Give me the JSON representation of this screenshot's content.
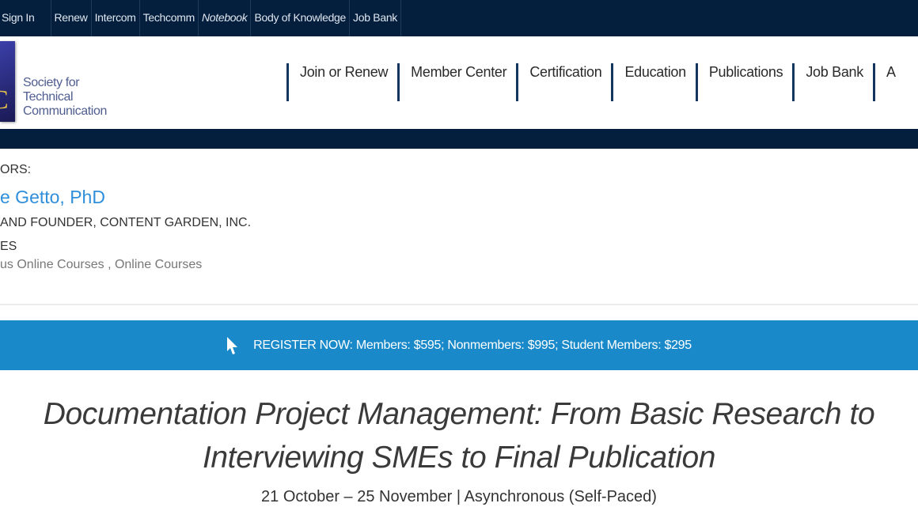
{
  "topbar": {
    "items": [
      "Sign In",
      "Renew",
      "Intercom",
      "Techcomm",
      "Notebook",
      "Body of Knowledge",
      "Job Bank"
    ]
  },
  "logo": {
    "lines": [
      "Society for",
      "Technical",
      "Communication"
    ],
    "mark": "C"
  },
  "nav": {
    "items": [
      "Join or Renew",
      "Member Center",
      "Certification",
      "Education",
      "Publications",
      "Job Bank",
      "A"
    ]
  },
  "content": {
    "instructors_label": "ORS:",
    "instructor_name": "e Getto, PhD",
    "instructor_title": "AND FOUNDER, CONTENT GARDEN, INC.",
    "categories_label": "ES",
    "categories_value": "us Online Courses , Online Courses"
  },
  "register": {
    "icon": "cursor-arrow-icon",
    "text": "REGISTER NOW: Members: $595; Nonmembers: $995; Student Members: $295"
  },
  "course": {
    "title_line1": "Documentation Project Management: From Basic Research to",
    "title_line2": "Interviewing SMEs to Final Publication",
    "dates": "21 October – 25 November | Asynchronous (Self-Paced)"
  },
  "colors": {
    "navy": "#041f3d",
    "accent_blue": "#1a89c9",
    "link_blue": "#2f8fdb"
  }
}
